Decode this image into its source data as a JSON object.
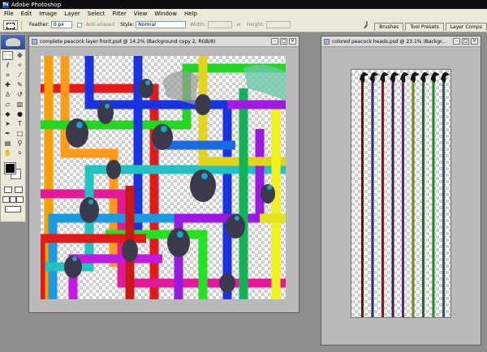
{
  "app": {
    "title": "Adobe Photoshop"
  },
  "menu": [
    "File",
    "Edit",
    "Image",
    "Layer",
    "Select",
    "Filter",
    "View",
    "Window",
    "Help"
  ],
  "options": {
    "feather_label": "Feather:",
    "feather_value": "0 px",
    "antialiased_label": "Anti-aliased",
    "style_label": "Style:",
    "style_value": "Normal",
    "width_label": "Width:",
    "height_label": "Height:"
  },
  "palette_well": [
    "Brushes",
    "Tool Presets",
    "Layer Comps"
  ],
  "colors": {
    "foreground": "#000000",
    "background": "#ffffff"
  },
  "doc1": {
    "title": "complete peacock layer front.psd @ 14.2% (Background copy 2, RGB/8)"
  },
  "doc2": {
    "title": "colored peacock heads.psd @ 23.1% (Backgr..."
  },
  "doc2_stripes": [
    "#5a1a1a",
    "#1e2e7a",
    "#7a1a1a",
    "#3a1a5a",
    "#5a2a6a",
    "#6a8a1a",
    "#2a6a2a",
    "#1a8a2a",
    "#2a5a7a"
  ]
}
